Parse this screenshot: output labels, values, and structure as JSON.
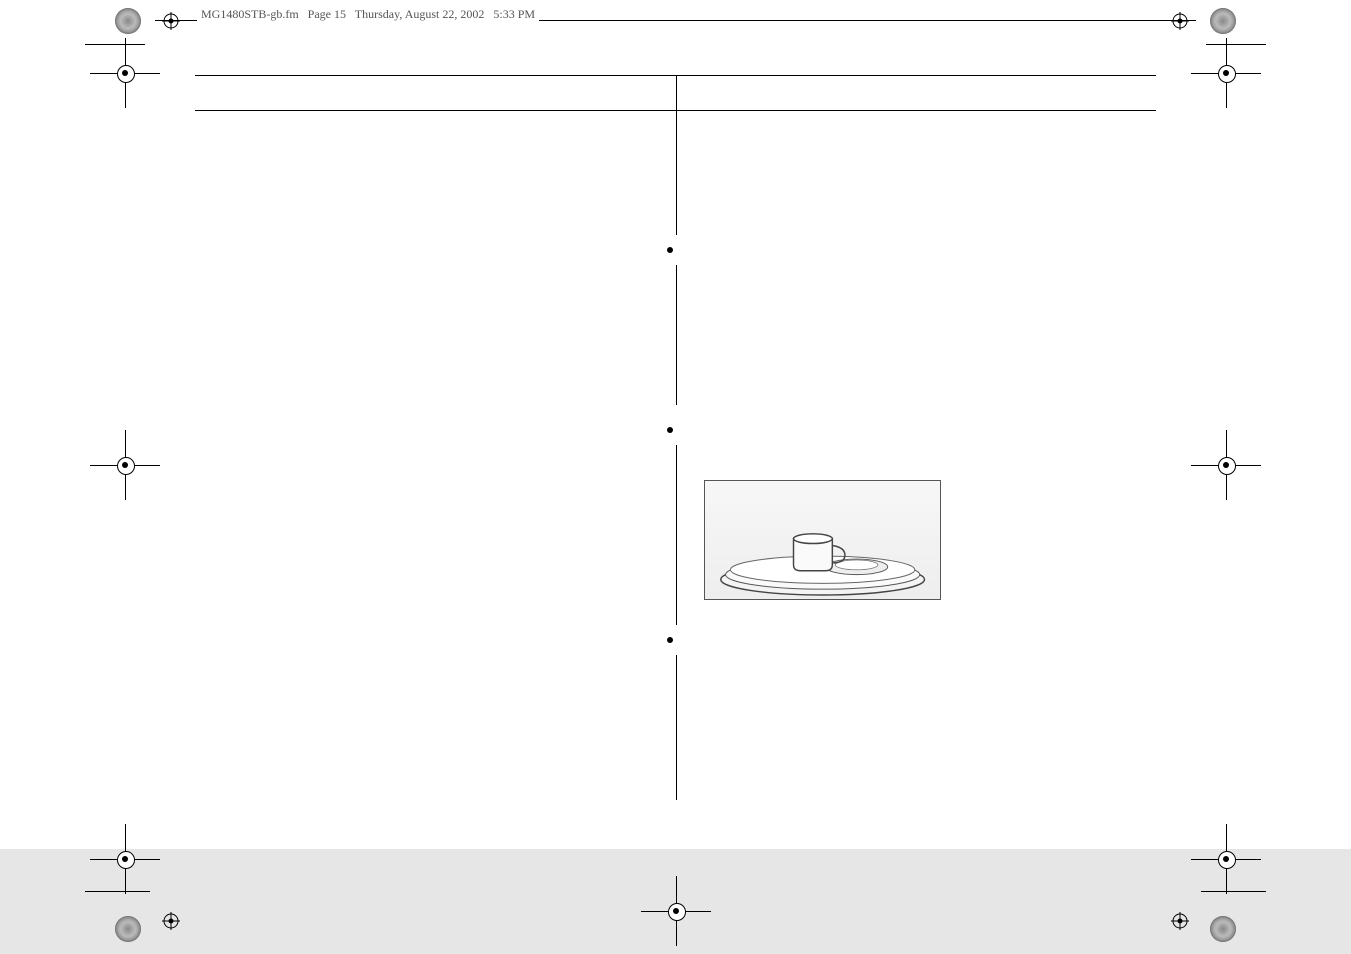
{
  "header": {
    "filename": "MG1480STB-gb.fm",
    "page_label": "Page 15",
    "day": "Thursday,",
    "date": "August 22, 2002",
    "time": "5:33 PM",
    "page_number": "15"
  },
  "columns": {
    "left_text": "",
    "right_items": [
      {
        "text": ""
      },
      {
        "text": ""
      },
      {
        "text": ""
      }
    ]
  },
  "illustration": {
    "alt": "Line drawing of dishes and a mug on a turntable inside an oven cavity"
  },
  "registration": {
    "label": "registration-mark"
  }
}
